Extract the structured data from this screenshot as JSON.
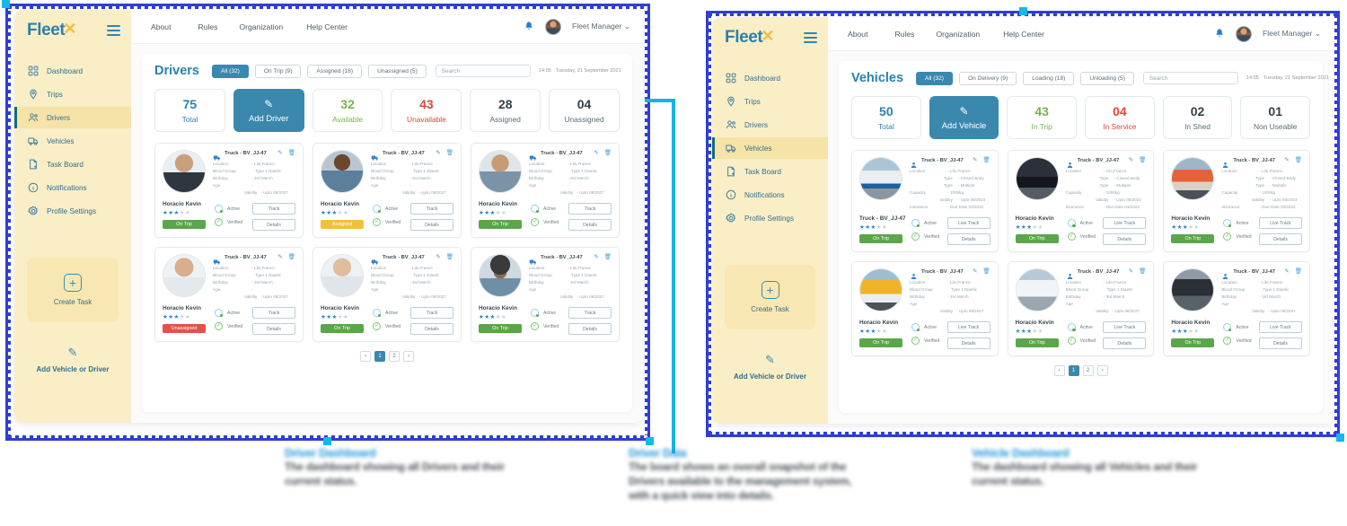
{
  "brand": {
    "word": "Fleet",
    "mark": "✕"
  },
  "sidebar": {
    "items": [
      {
        "label": "Dashboard",
        "icon": "grid-icon"
      },
      {
        "label": "Trips",
        "icon": "pin-icon"
      },
      {
        "label": "Drivers",
        "icon": "users-icon"
      },
      {
        "label": "Vehicles",
        "icon": "truck-icon"
      },
      {
        "label": "Task Board",
        "icon": "document-icon"
      },
      {
        "label": "Notifications",
        "icon": "info-icon"
      },
      {
        "label": "Profile Settings",
        "icon": "gear-icon"
      }
    ],
    "create_task": "Create Task",
    "create_task_icon": "plus-icon",
    "add_vehicle_or_driver": "Add Vehicle or Driver",
    "add_icon": "pencil-icon"
  },
  "topnav": {
    "links": [
      "About",
      "Rules",
      "Organization",
      "Help Center"
    ],
    "bell_icon": "bell-icon",
    "user": "Fleet Manager",
    "caret": "⌄"
  },
  "drivers_panel": {
    "title": "Drivers",
    "chips": [
      {
        "label": "All (32)",
        "active": true
      },
      {
        "label": "On Trip (9)",
        "active": false
      },
      {
        "label": "Assigned (18)",
        "active": false
      },
      {
        "label": "Unassigned (5)",
        "active": false
      }
    ],
    "search_placeholder": "Search",
    "time": "14:05",
    "date": "Tuesday, 21 September 2021",
    "stats": [
      {
        "num": "75",
        "label": "Total",
        "kind": "total"
      },
      {
        "num": "",
        "label": "Add  Driver",
        "kind": "cta"
      },
      {
        "num": "32",
        "label": "Available",
        "kind": "good"
      },
      {
        "num": "43",
        "label": "Unavailable",
        "kind": "bad"
      },
      {
        "num": "28",
        "label": "Assigned",
        "kind": "plain"
      },
      {
        "num": "04",
        "label": "Unassigned",
        "kind": "plain"
      }
    ],
    "field_labels": {
      "location": "Location",
      "blood": "Blood Group",
      "birthday": "Birthday",
      "age": "Age",
      "validity": "Validity"
    },
    "field_values": {
      "location": "- Lile,France",
      "blood": "Type 1 Diaetic",
      "birthday": "- 3rd March",
      "age": "-",
      "validity": "- Upto 08/2027"
    },
    "card_title": "Truck - BV_JJ-47",
    "status_active": "Active",
    "status_verified": "Verified",
    "btn_track": "Track",
    "btn_details": "Details",
    "cards": [
      {
        "name": "Horacio Kevin",
        "stars": 3,
        "badge": "On Trip",
        "badge_kind": "ontrip",
        "photo": "p1"
      },
      {
        "name": "Horacio Kevin",
        "stars": 3,
        "badge": "Assigned",
        "badge_kind": "assigned",
        "photo": "p2"
      },
      {
        "name": "Horacio Kevin",
        "stars": 3,
        "badge": "On Trip",
        "badge_kind": "ontrip",
        "photo": "p3"
      },
      {
        "name": "Horacio Kevin",
        "stars": 3,
        "badge": "Unassigned",
        "badge_kind": "unassigned",
        "photo": "p4"
      },
      {
        "name": "Horacio Kevin",
        "stars": 3,
        "badge": "On Trip",
        "badge_kind": "ontrip",
        "photo": "p5"
      },
      {
        "name": "Horacio Kevin",
        "stars": 3,
        "badge": "On Trip",
        "badge_kind": "ontrip",
        "photo": "p6"
      }
    ],
    "pager": {
      "prev": "‹",
      "next": "›",
      "pages": [
        "1",
        "2"
      ],
      "current": "1"
    }
  },
  "vehicles_panel": {
    "title": "Vehicles",
    "chips": [
      {
        "label": "All (32)",
        "active": true
      },
      {
        "label": "On Delivery (9)",
        "active": false
      },
      {
        "label": "Loading (18)",
        "active": false
      },
      {
        "label": "Unloading (5)",
        "active": false
      }
    ],
    "search_placeholder": "Search",
    "time": "14:05",
    "date": "Tuesday, 21 September 2021",
    "stats": [
      {
        "num": "50",
        "label": "Total",
        "kind": "total"
      },
      {
        "num": "",
        "label": "Add  Vehicle",
        "kind": "cta"
      },
      {
        "num": "43",
        "label": "In Trip",
        "kind": "good"
      },
      {
        "num": "04",
        "label": "In Service",
        "kind": "bad"
      },
      {
        "num": "02",
        "label": "In Shed",
        "kind": "plain"
      },
      {
        "num": "01",
        "label": "Non Useable",
        "kind": "plain"
      }
    ],
    "vehicle_field_labels": {
      "location": "Location",
      "type1": "Type",
      "type2": "Type",
      "capacity": "Capacity",
      "validity": "Validity",
      "insurance": "Insurance"
    },
    "vehicle_field_values": {
      "location": "- Lile,France",
      "type1": "- Closed Body",
      "type2": "- Multiple",
      "capacity": "- 1000kg",
      "validity": "- Upto 08/2023",
      "insurance": "- Due Date 03/2022"
    },
    "driver_field_labels": {
      "location": "Location",
      "blood": "Blood Group",
      "birthday": "Birthday",
      "age": "Age",
      "validity": "Validity"
    },
    "driver_field_values": {
      "location": "- Lile,France",
      "blood": "Type 1 Diaetic",
      "birthday": "- 3rd March",
      "age": "-",
      "validity": "- Upto 08/2027"
    },
    "card_title": "Truck - BV_JJ-47",
    "status_active": "Active",
    "status_verified": "Verified",
    "btn_track": "Live Track",
    "btn_details": "Details",
    "cards": [
      {
        "name": "Truck - BV_JJ-47",
        "stars": 3,
        "badge": "On Trip",
        "badge_kind": "ontrip",
        "photo": "v1",
        "fieldset": "vehicle"
      },
      {
        "name": "Horacio Kevin",
        "stars": 3,
        "badge": "On Trip",
        "badge_kind": "ontrip",
        "photo": "v2",
        "fieldset": "vehicle"
      },
      {
        "name": "Horacio Kevin",
        "stars": 3,
        "badge": "On Trip",
        "badge_kind": "ontrip",
        "photo": "v3",
        "fieldset": "vehicle"
      },
      {
        "name": "Horacio Kevin",
        "stars": 3,
        "badge": "On Trip",
        "badge_kind": "ontrip",
        "photo": "v4",
        "fieldset": "driver"
      },
      {
        "name": "Horacio Kevin",
        "stars": 3,
        "badge": "On Trip",
        "badge_kind": "ontrip",
        "photo": "v5",
        "fieldset": "driver"
      },
      {
        "name": "Horacio Kevin",
        "stars": 3,
        "badge": "On Trip",
        "badge_kind": "ontrip",
        "photo": "v6",
        "fieldset": "driver"
      }
    ],
    "pager": {
      "prev": "‹",
      "next": "›",
      "pages": [
        "1",
        "2"
      ],
      "current": "1"
    }
  },
  "captions": [
    {
      "title": "Driver Dashboard",
      "body": "The dashboard showing all Drivers and their current status."
    },
    {
      "title": "Driver Data",
      "body": "The board shows an overall snapshot of the Drivers available to the management system, with a quick view into details."
    },
    {
      "title": "Vehicle Dashboard",
      "body": "The dashboard showing all Vehicles and their current status."
    }
  ],
  "colors": {
    "accent": "#3a88ad",
    "sidebar": "#faeec6",
    "good": "#78b24b",
    "bad": "#e2433b",
    "selection": "#2f3fd4",
    "connector": "#16b5e0"
  }
}
